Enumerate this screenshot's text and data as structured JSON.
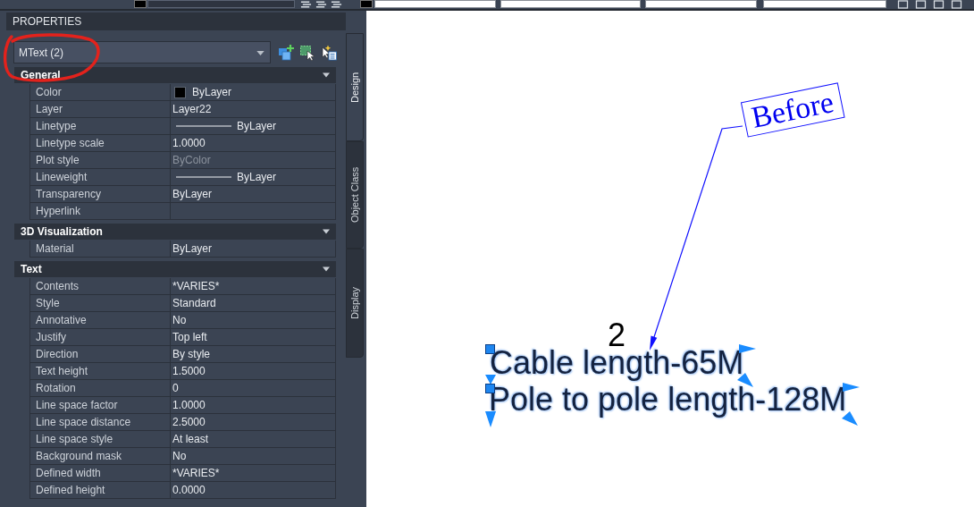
{
  "palette": {
    "title": "PROPERTIES",
    "selection": {
      "value": "MText (2)"
    },
    "sections": [
      {
        "title": "General",
        "expanded": true,
        "rows": [
          {
            "label": "Color",
            "value": "ByLayer",
            "kind": "color",
            "color": "#000000"
          },
          {
            "label": "Layer",
            "value": "Layer22",
            "kind": "plain"
          },
          {
            "label": "Linetype",
            "value": "ByLayer",
            "kind": "line"
          },
          {
            "label": "Linetype scale",
            "value": "1.0000",
            "kind": "plain"
          },
          {
            "label": "Plot style",
            "value": "ByColor",
            "kind": "muted"
          },
          {
            "label": "Lineweight",
            "value": "ByLayer",
            "kind": "line"
          },
          {
            "label": "Transparency",
            "value": "ByLayer",
            "kind": "plain"
          },
          {
            "label": "Hyperlink",
            "kind": "empty"
          }
        ]
      },
      {
        "title": "3D Visualization",
        "expanded": true,
        "rows": [
          {
            "label": "Material",
            "value": "ByLayer",
            "kind": "plain"
          }
        ]
      },
      {
        "title": "Text",
        "expanded": true,
        "rows": [
          {
            "label": "Contents",
            "value": "*VARIES*",
            "kind": "plain"
          },
          {
            "label": "Style",
            "value": "Standard",
            "kind": "plain"
          },
          {
            "label": "Annotative",
            "value": "No",
            "kind": "plain"
          },
          {
            "label": "Justify",
            "value": "Top left",
            "kind": "plain"
          },
          {
            "label": "Direction",
            "value": "By style",
            "kind": "plain"
          },
          {
            "label": "Text height",
            "value": "1.5000",
            "kind": "plain"
          },
          {
            "label": "Rotation",
            "value": "0",
            "kind": "plain"
          },
          {
            "label": "Line space factor",
            "value": "1.0000",
            "kind": "plain"
          },
          {
            "label": "Line space distance",
            "value": "2.5000",
            "kind": "plain"
          },
          {
            "label": "Line space style",
            "value": "At least",
            "kind": "plain"
          },
          {
            "label": "Background mask",
            "value": "No",
            "kind": "plain"
          },
          {
            "label": "Defined width",
            "value": "*VARIES*",
            "kind": "plain"
          },
          {
            "label": "Defined height",
            "value": "0.0000",
            "kind": "plain"
          }
        ]
      }
    ],
    "side_tabs": [
      {
        "label": "Design",
        "selected": true
      },
      {
        "label": "Object Class",
        "selected": false
      },
      {
        "label": "Display",
        "selected": false
      }
    ]
  },
  "drawing": {
    "callout": {
      "text": "Before"
    },
    "label": "2",
    "mtext": [
      {
        "text": "Cable length-65M",
        "selected": true
      },
      {
        "text": "Pole to pole length-128M",
        "selected": true
      }
    ]
  }
}
